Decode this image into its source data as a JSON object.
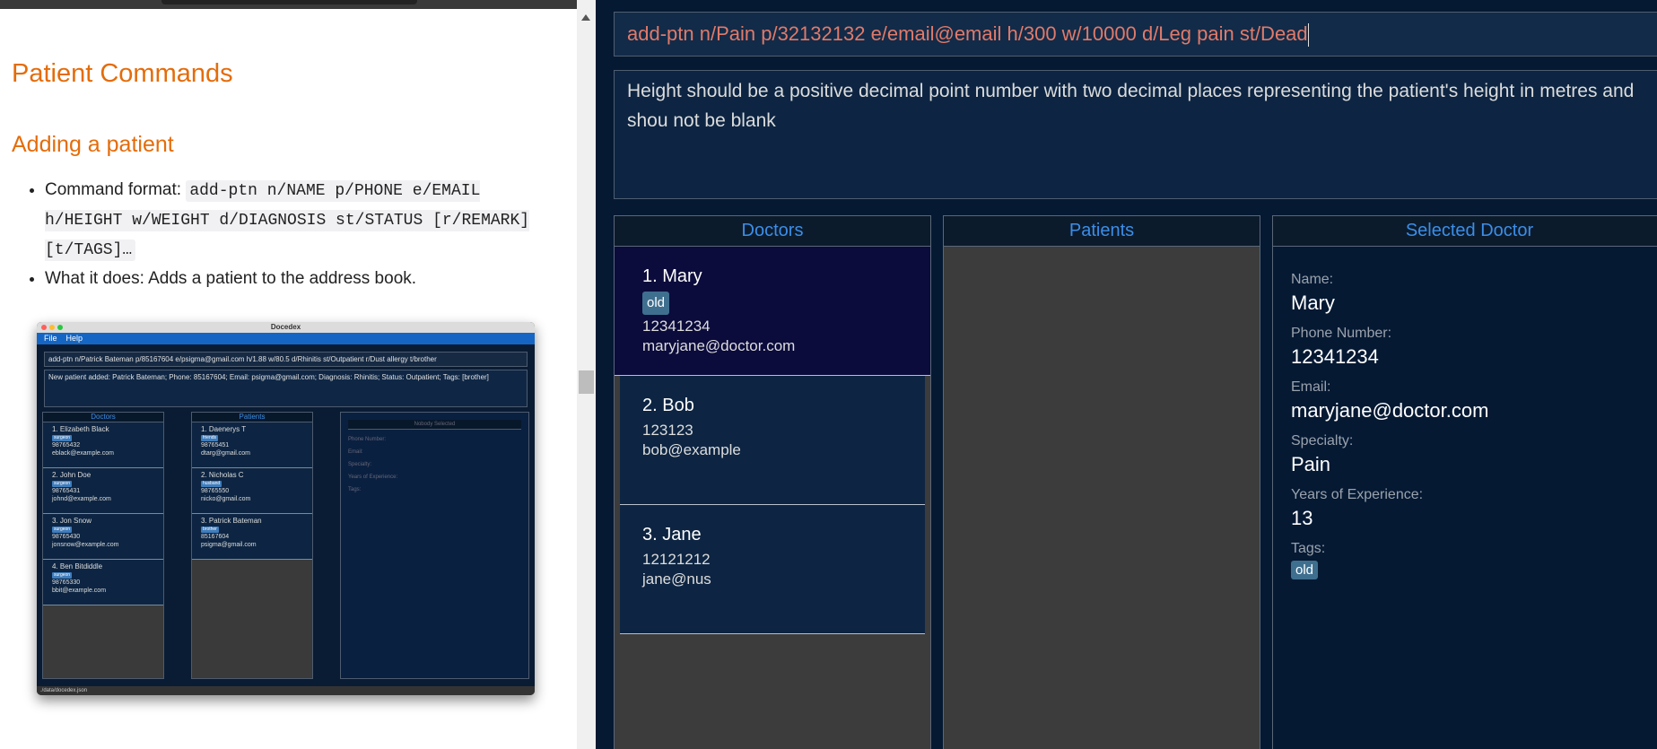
{
  "doc": {
    "section_title": "Patient Commands",
    "subsection_title": "Adding a patient",
    "bullets": [
      {
        "prefix": "Command format: ",
        "code": "add-ptn n/NAME p/PHONE e/EMAIL h/HEIGHT w/WEIGHT d/DIAGNOSIS st/STATUS [r/REMARK] [t/TAGS]…"
      },
      {
        "prefix": "What it does: Adds a patient to the address book.",
        "code": ""
      }
    ]
  },
  "embedded": {
    "window_title": "Docedex",
    "menu": [
      "File",
      "Help"
    ],
    "command": "add-ptn n/Patrick Bateman p/85167604 e/psigma@gmail.com h/1.88 w/80.5 d/Rhinitis st/Outpatient r/Dust allergy t/brother",
    "result": "New patient added: Patrick Bateman; Phone: 85167604; Email: psigma@gmail.com; Diagnosis: Rhinitis; Status: Outpatient; Tags: [brother]",
    "doctors_header": "Doctors",
    "patients_header": "Patients",
    "selected_header": "Nobody Selected",
    "doctors": [
      {
        "name": "1.  Elizabeth Black",
        "tag": "surgeon",
        "phone": "98765432",
        "email": "eblack@example.com"
      },
      {
        "name": "2.  John Doe",
        "tag": "surgeon",
        "phone": "98765431",
        "email": "johnd@example.com"
      },
      {
        "name": "3.  Jon Snow",
        "tag": "surgeon",
        "phone": "98765430",
        "email": "jonsnow@example.com"
      },
      {
        "name": "4.  Ben Bitdiddle",
        "tag": "surgeon",
        "phone": "98765330",
        "email": "bbit@example.com"
      }
    ],
    "patients": [
      {
        "name": "1.  Daenerys T",
        "tag": "friends",
        "phone": "98765451",
        "email": "dtarg@gmail.com"
      },
      {
        "name": "2.  Nicholas C",
        "tag": "husband",
        "phone": "98765550",
        "email": "nicko@gmail.com"
      },
      {
        "name": "3.  Patrick Bateman",
        "tag": "brother",
        "phone": "85167604",
        "email": "psigma@gmail.com"
      }
    ],
    "selected_labels": [
      "Phone Number:",
      "Email:",
      "Specialty:",
      "Years of Experience:",
      "Tags:"
    ],
    "status": "./data/docedex.json"
  },
  "app": {
    "command": "add-ptn n/Pain p/32132132 e/email@email h/300 w/10000 d/Leg pain st/Dead",
    "result": "Height should be a positive decimal point number with two decimal places representing the patient's height in metres and shou not be blank",
    "doctors_header": "Doctors",
    "patients_header": "Patients",
    "selected_header": "Selected Doctor",
    "doctors": [
      {
        "name": "1.  Mary",
        "tag": "old",
        "phone": "12341234",
        "email": "maryjane@doctor.com"
      },
      {
        "name": "2.  Bob",
        "tag": "",
        "phone": "123123",
        "email": "bob@example"
      },
      {
        "name": "3.  Jane",
        "tag": "",
        "phone": "12121212",
        "email": "jane@nus"
      }
    ],
    "selected": {
      "name_label": "Name:",
      "name": "Mary",
      "phone_label": "Phone Number:",
      "phone": "12341234",
      "email_label": "Email:",
      "email": "maryjane@doctor.com",
      "specialty_label": "Specialty:",
      "specialty": "Pain",
      "years_label": "Years of Experience:",
      "years": "13",
      "tags_label": "Tags:",
      "tag": "old"
    }
  },
  "colors": {
    "heading": "#e46c0a",
    "accent": "#3b8ee8",
    "app_bg": "#051933",
    "error_text": "#e07a6a"
  }
}
